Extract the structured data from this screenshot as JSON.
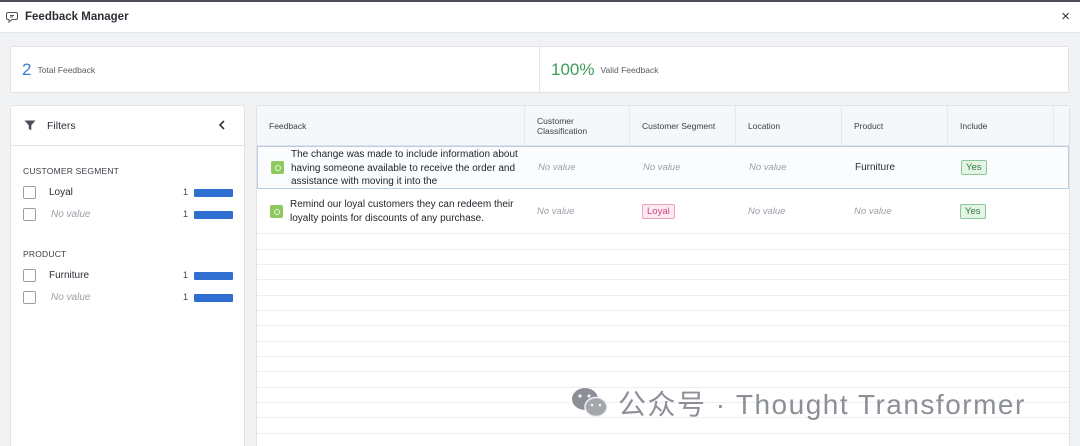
{
  "window": {
    "title": "Feedback Manager",
    "close_label": "×"
  },
  "stats": {
    "total_value": "2",
    "total_label": "Total Feedback",
    "valid_value": "100%",
    "valid_label": "Valid Feedback"
  },
  "filters": {
    "title": "Filters",
    "groups": [
      {
        "title": "CUSTOMER SEGMENT",
        "items": [
          {
            "label": "Loyal",
            "count": "1",
            "share": 1.0
          },
          {
            "label": "No value",
            "count": "1",
            "share": 1.0
          }
        ]
      },
      {
        "title": "PRODUCT",
        "items": [
          {
            "label": "Furniture",
            "count": "1",
            "share": 1.0
          },
          {
            "label": "No value",
            "count": "1",
            "share": 1.0
          }
        ]
      }
    ]
  },
  "table": {
    "columns": [
      "Feedback",
      "Customer Classification",
      "Customer Segment",
      "Location",
      "Product",
      "Include"
    ],
    "rows": [
      {
        "feedback": "The change was made to include information about having someone available to receive the order and assistance with moving it into the",
        "classification": "No value",
        "segment": "No value",
        "location": "No value",
        "product": "Furniture",
        "include": "Yes"
      },
      {
        "feedback": "Remind our loyal customers they can redeem their loyalty points for discounts of any purchase.",
        "classification": "No value",
        "segment": "Loyal",
        "location": "No value",
        "product": "No value",
        "include": "Yes"
      }
    ]
  },
  "watermark": {
    "text": "公众号 · Thought Transformer"
  },
  "colors": {
    "accent_blue": "#2f6fd1",
    "valid_green": "#3f9b59",
    "feedback_icon_green": "#8dc95e"
  }
}
